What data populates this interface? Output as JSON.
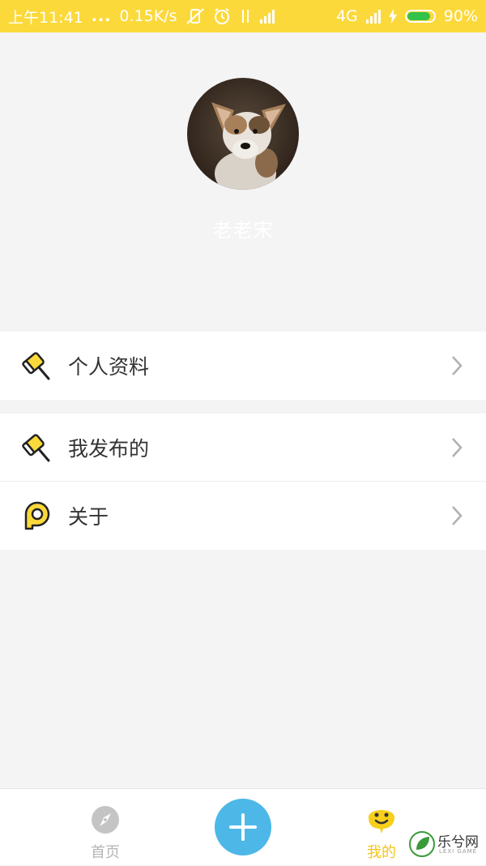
{
  "status_bar": {
    "time": "上午11:41",
    "dots": "...",
    "speed": "0.15K/s",
    "network": "4G",
    "battery": "90%",
    "battery_level": 0.9
  },
  "profile": {
    "username": "老老宋"
  },
  "menu": {
    "items": [
      {
        "label": "个人资料",
        "icon": "hammer-icon"
      },
      {
        "label": "我发布的",
        "icon": "hammer-icon"
      },
      {
        "label": "关于",
        "icon": "p-logo-icon"
      }
    ]
  },
  "bottom_nav": {
    "items": [
      {
        "label": "首页",
        "icon": "compass-icon",
        "active": false
      },
      {
        "label": "我的",
        "icon": "smiley-icon",
        "active": true
      }
    ],
    "fab_icon": "plus-icon"
  },
  "watermark": {
    "text": "乐兮网",
    "subtext": "LEXI GAME"
  },
  "colors": {
    "accent": "#fcd93b",
    "fab": "#4db8e8",
    "active_tab": "#f5c518",
    "inactive_tab": "#b5b5b5"
  }
}
